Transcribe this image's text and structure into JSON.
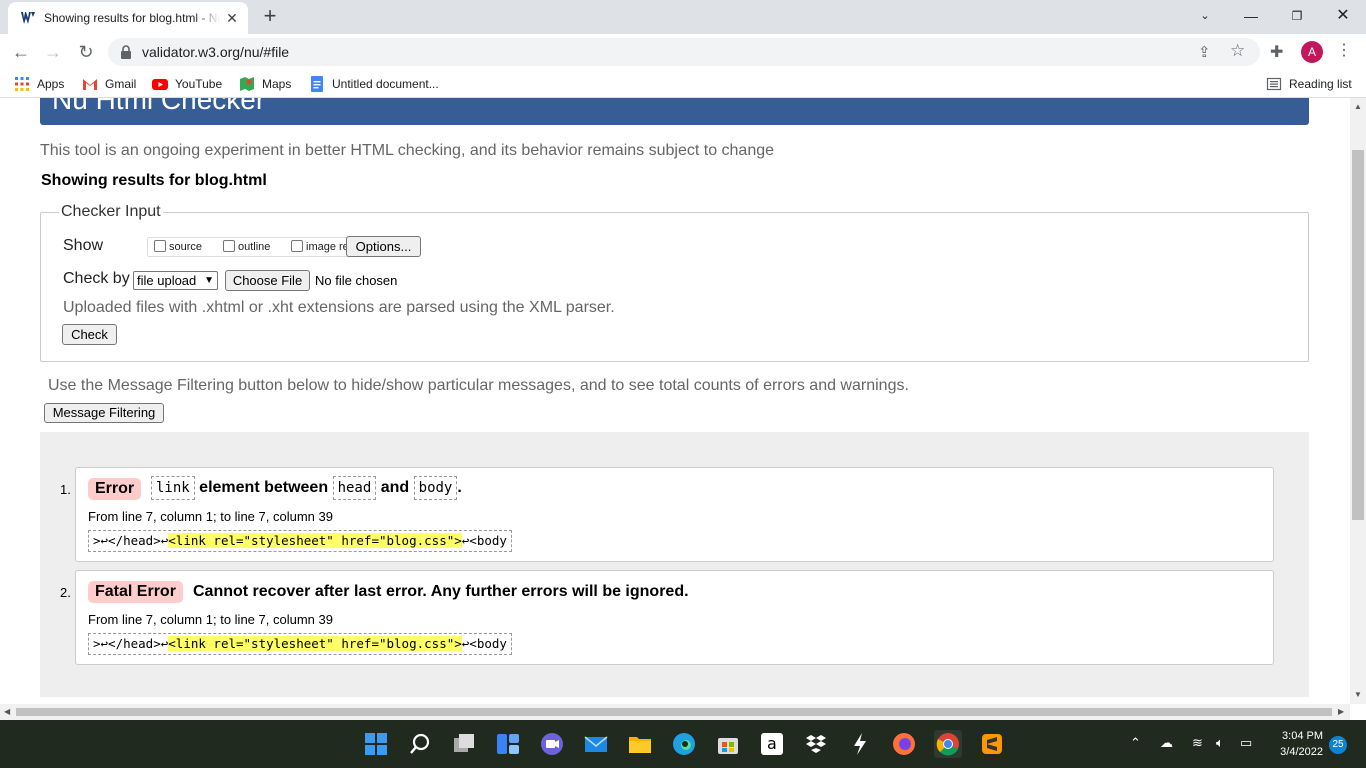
{
  "browser": {
    "tab_title": "Showing results for blog.html - Nu Html Checker",
    "tab_close": "✕",
    "new_tab": "+",
    "url": "validator.w3.org/nu/#file",
    "bookmarks": [
      {
        "label": "Apps",
        "icon": "apps-grid-icon"
      },
      {
        "label": "Gmail",
        "icon": "gmail-icon"
      },
      {
        "label": "YouTube",
        "icon": "youtube-icon"
      },
      {
        "label": "Maps",
        "icon": "maps-icon"
      },
      {
        "label": "Untitled document...",
        "icon": "docs-icon"
      }
    ],
    "reading_list": "Reading list",
    "avatar_letter": "A"
  },
  "page": {
    "banner_title": "Nu Html Checker",
    "intro": "This tool is an ongoing experiment in better HTML checking, and its behavior remains subject to change",
    "results_heading": "Showing results for blog.html",
    "checker_input": {
      "legend": "Checker Input",
      "show_label": "Show",
      "checkboxes": [
        "source",
        "outline",
        "image report"
      ],
      "options_button": "Options...",
      "check_by_label": "Check by",
      "check_by_value": "file upload",
      "choose_file_button": "Choose File",
      "no_file": "No file chosen",
      "xml_note": "Uploaded files with .xhtml or .xht extensions are parsed using the XML parser.",
      "check_button": "Check"
    },
    "filter_note": "Use the Message Filtering button below to hide/show particular messages, and to see total counts of errors and warnings.",
    "filter_button": "Message Filtering",
    "messages": [
      {
        "num": "1.",
        "type": "Error",
        "code1": "link",
        "text1": "element between",
        "code2": "head",
        "text2": "and",
        "code3": "body",
        "text3": ".",
        "location": "From line 7, column 1; to line 7, column 39",
        "extract_pre": ">↩</head>↩",
        "extract_mark": "<link rel=\"stylesheet\" href=\"blog.css\">",
        "extract_post": "↩<body"
      },
      {
        "num": "2.",
        "type": "Fatal Error",
        "text": "Cannot recover after last error. Any further errors will be ignored.",
        "location": "From line 7, column 1; to line 7, column 39",
        "extract_pre": ">↩</head>↩",
        "extract_mark": "<link rel=\"stylesheet\" href=\"blog.css\">",
        "extract_post": "↩<body"
      }
    ]
  },
  "taskbar": {
    "time": "3:04 PM",
    "date": "3/4/2022",
    "notifications": "25"
  },
  "colors": {
    "banner": "#365d95",
    "badge": "#ffcccc",
    "highlight": "#ffff66",
    "taskbar": "#202a1f"
  }
}
